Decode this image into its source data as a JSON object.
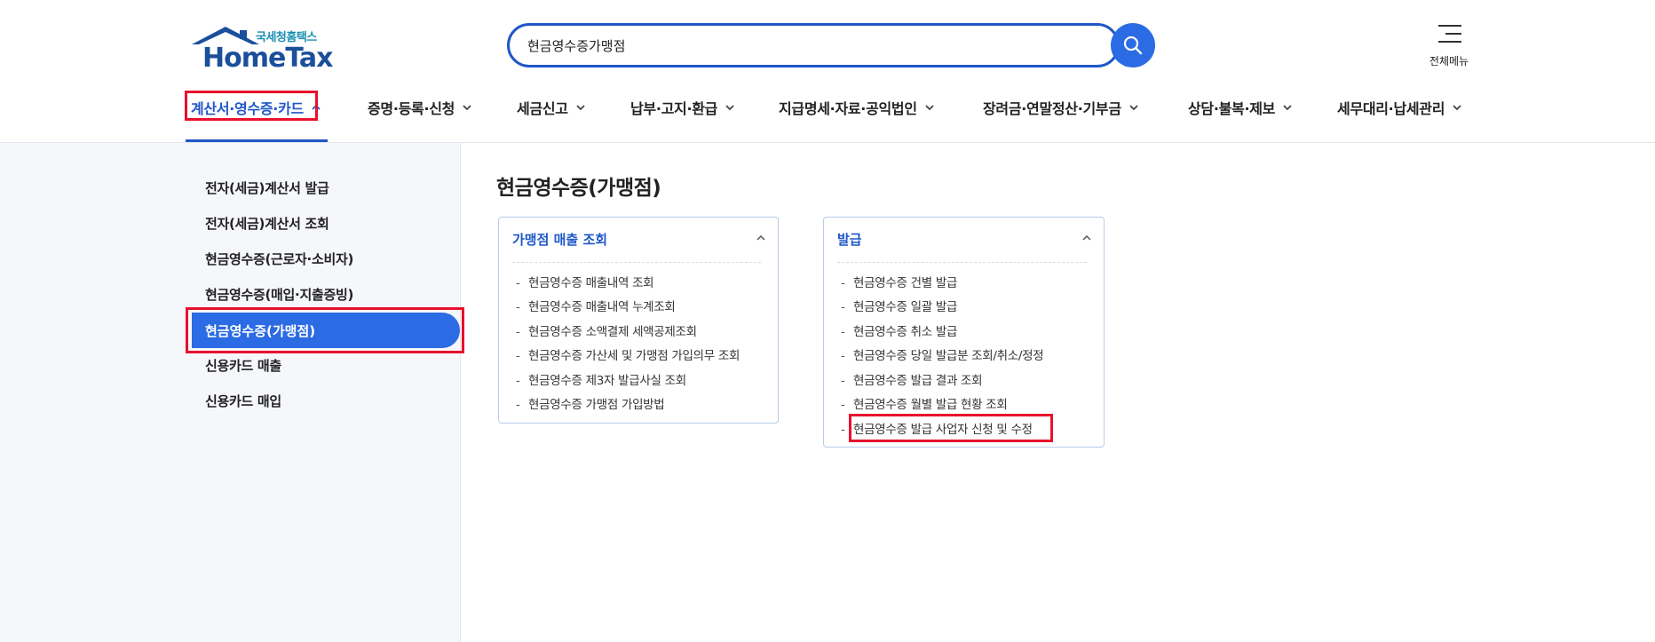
{
  "header": {
    "logo_sub": "국세청홈택스",
    "logo_main": "HomeTax",
    "search": {
      "value": "현금영수증가맹점"
    },
    "allmenu_label": "전체메뉴"
  },
  "gnb": [
    {
      "label": "계산서·영수증·카드",
      "active": true
    },
    {
      "label": "증명·등록·신청"
    },
    {
      "label": "세금신고"
    },
    {
      "label": "납부·고지·환급"
    },
    {
      "label": "지급명세·자료·공익법인"
    },
    {
      "label": "장려금·연말정산·기부금"
    },
    {
      "label": "상담·불복·제보"
    },
    {
      "label": "세무대리·납세관리"
    }
  ],
  "sidebar": {
    "items": [
      {
        "label": "전자(세금)계산서 발급"
      },
      {
        "label": "전자(세금)계산서 조회"
      },
      {
        "label": "현금영수증(근로자·소비자)"
      },
      {
        "label": "현금영수증(매입·지출증빙)"
      },
      {
        "label": "현금영수증(가맹점)",
        "active": true
      },
      {
        "label": "신용카드 매출"
      },
      {
        "label": "신용카드 매입"
      }
    ]
  },
  "main": {
    "title": "현금영수증(가맹점)",
    "cards": [
      {
        "title": "가맹점 매출 조회",
        "items": [
          "현금영수증 매출내역 조회",
          "현금영수증 매출내역 누계조회",
          "현금영수증 소액결제 세액공제조회",
          "현금영수증 가산세 및 가맹점 가입의무 조회",
          "현금영수증 제3자 발급사실 조회",
          "현금영수증 가맹점 가입방법"
        ]
      },
      {
        "title": "발급",
        "items": [
          "현금영수증 건별 발급",
          "현금영수증 일괄 발급",
          "현금영수증 취소 발급",
          "현금영수증 당일 발급분 조회/취소/정정",
          "현금영수증 발급 결과 조회",
          "현금영수증 월별 발급 현황 조회",
          "현금영수증 발급 사업자 신청 및 수정"
        ]
      }
    ]
  },
  "colors": {
    "primary": "#1f57c8",
    "active_bg": "#2b6be4",
    "highlight": "#e8112d",
    "sidebar_bg": "#f5f7fb"
  }
}
